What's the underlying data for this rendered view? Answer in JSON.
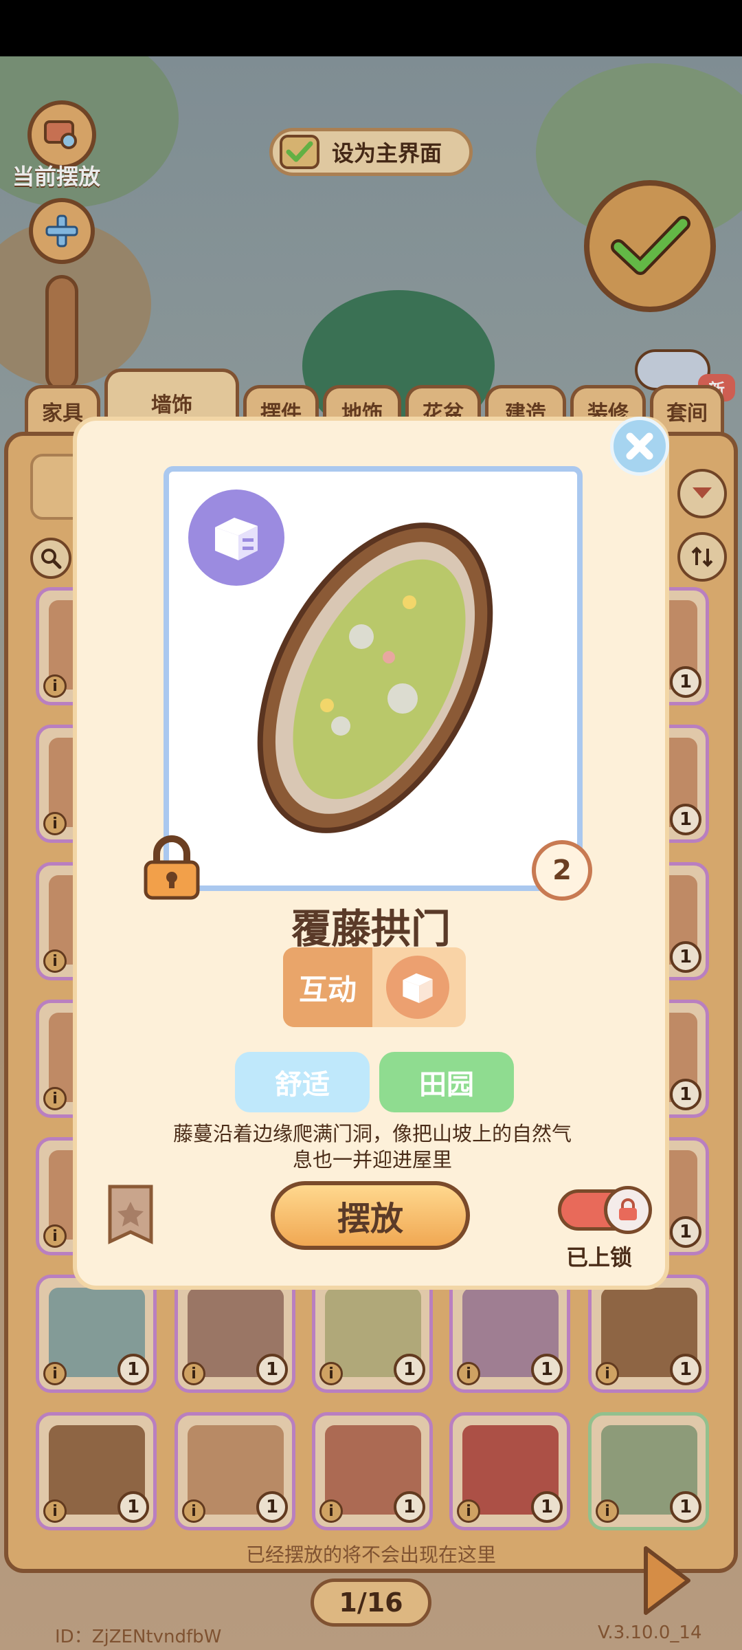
{
  "hud": {
    "current_placed_label": "当前摆放",
    "set_main_label": "设为主界面",
    "new_badge": "新"
  },
  "tabs": [
    "家具",
    "墙饰",
    "摆件",
    "地饰",
    "花盆",
    "建造",
    "装修",
    "套间"
  ],
  "grid": {
    "counts": [
      "1",
      "1",
      "1",
      "1",
      "1",
      "1",
      "1",
      "1",
      "1",
      "1"
    ],
    "footer_note": "已经摆放的将不会出现在这里",
    "page": "1/16",
    "id_text": "ID：ZjZENtvndfbW",
    "version": "V.3.10.0_14"
  },
  "side_counts": [
    "1",
    "1",
    "1",
    "1",
    "1",
    "1",
    "1",
    "1",
    "1",
    "1"
  ],
  "dialog": {
    "item_name": "覆藤拱门",
    "count": "2",
    "interact_label": "互动",
    "tags": [
      "舒适",
      "田园"
    ],
    "description": "藤蔓沿着边缘爬满门洞，像把山坡上的自然气息也一并迎进屋里",
    "place_button": "摆放",
    "lock_label": "已上锁"
  },
  "colors": {
    "accent_orange": "#f0a853",
    "tag_comfort": "#bfe8fb",
    "tag_pastoral": "#8fdc90",
    "frame_blue": "#aac8ef"
  }
}
